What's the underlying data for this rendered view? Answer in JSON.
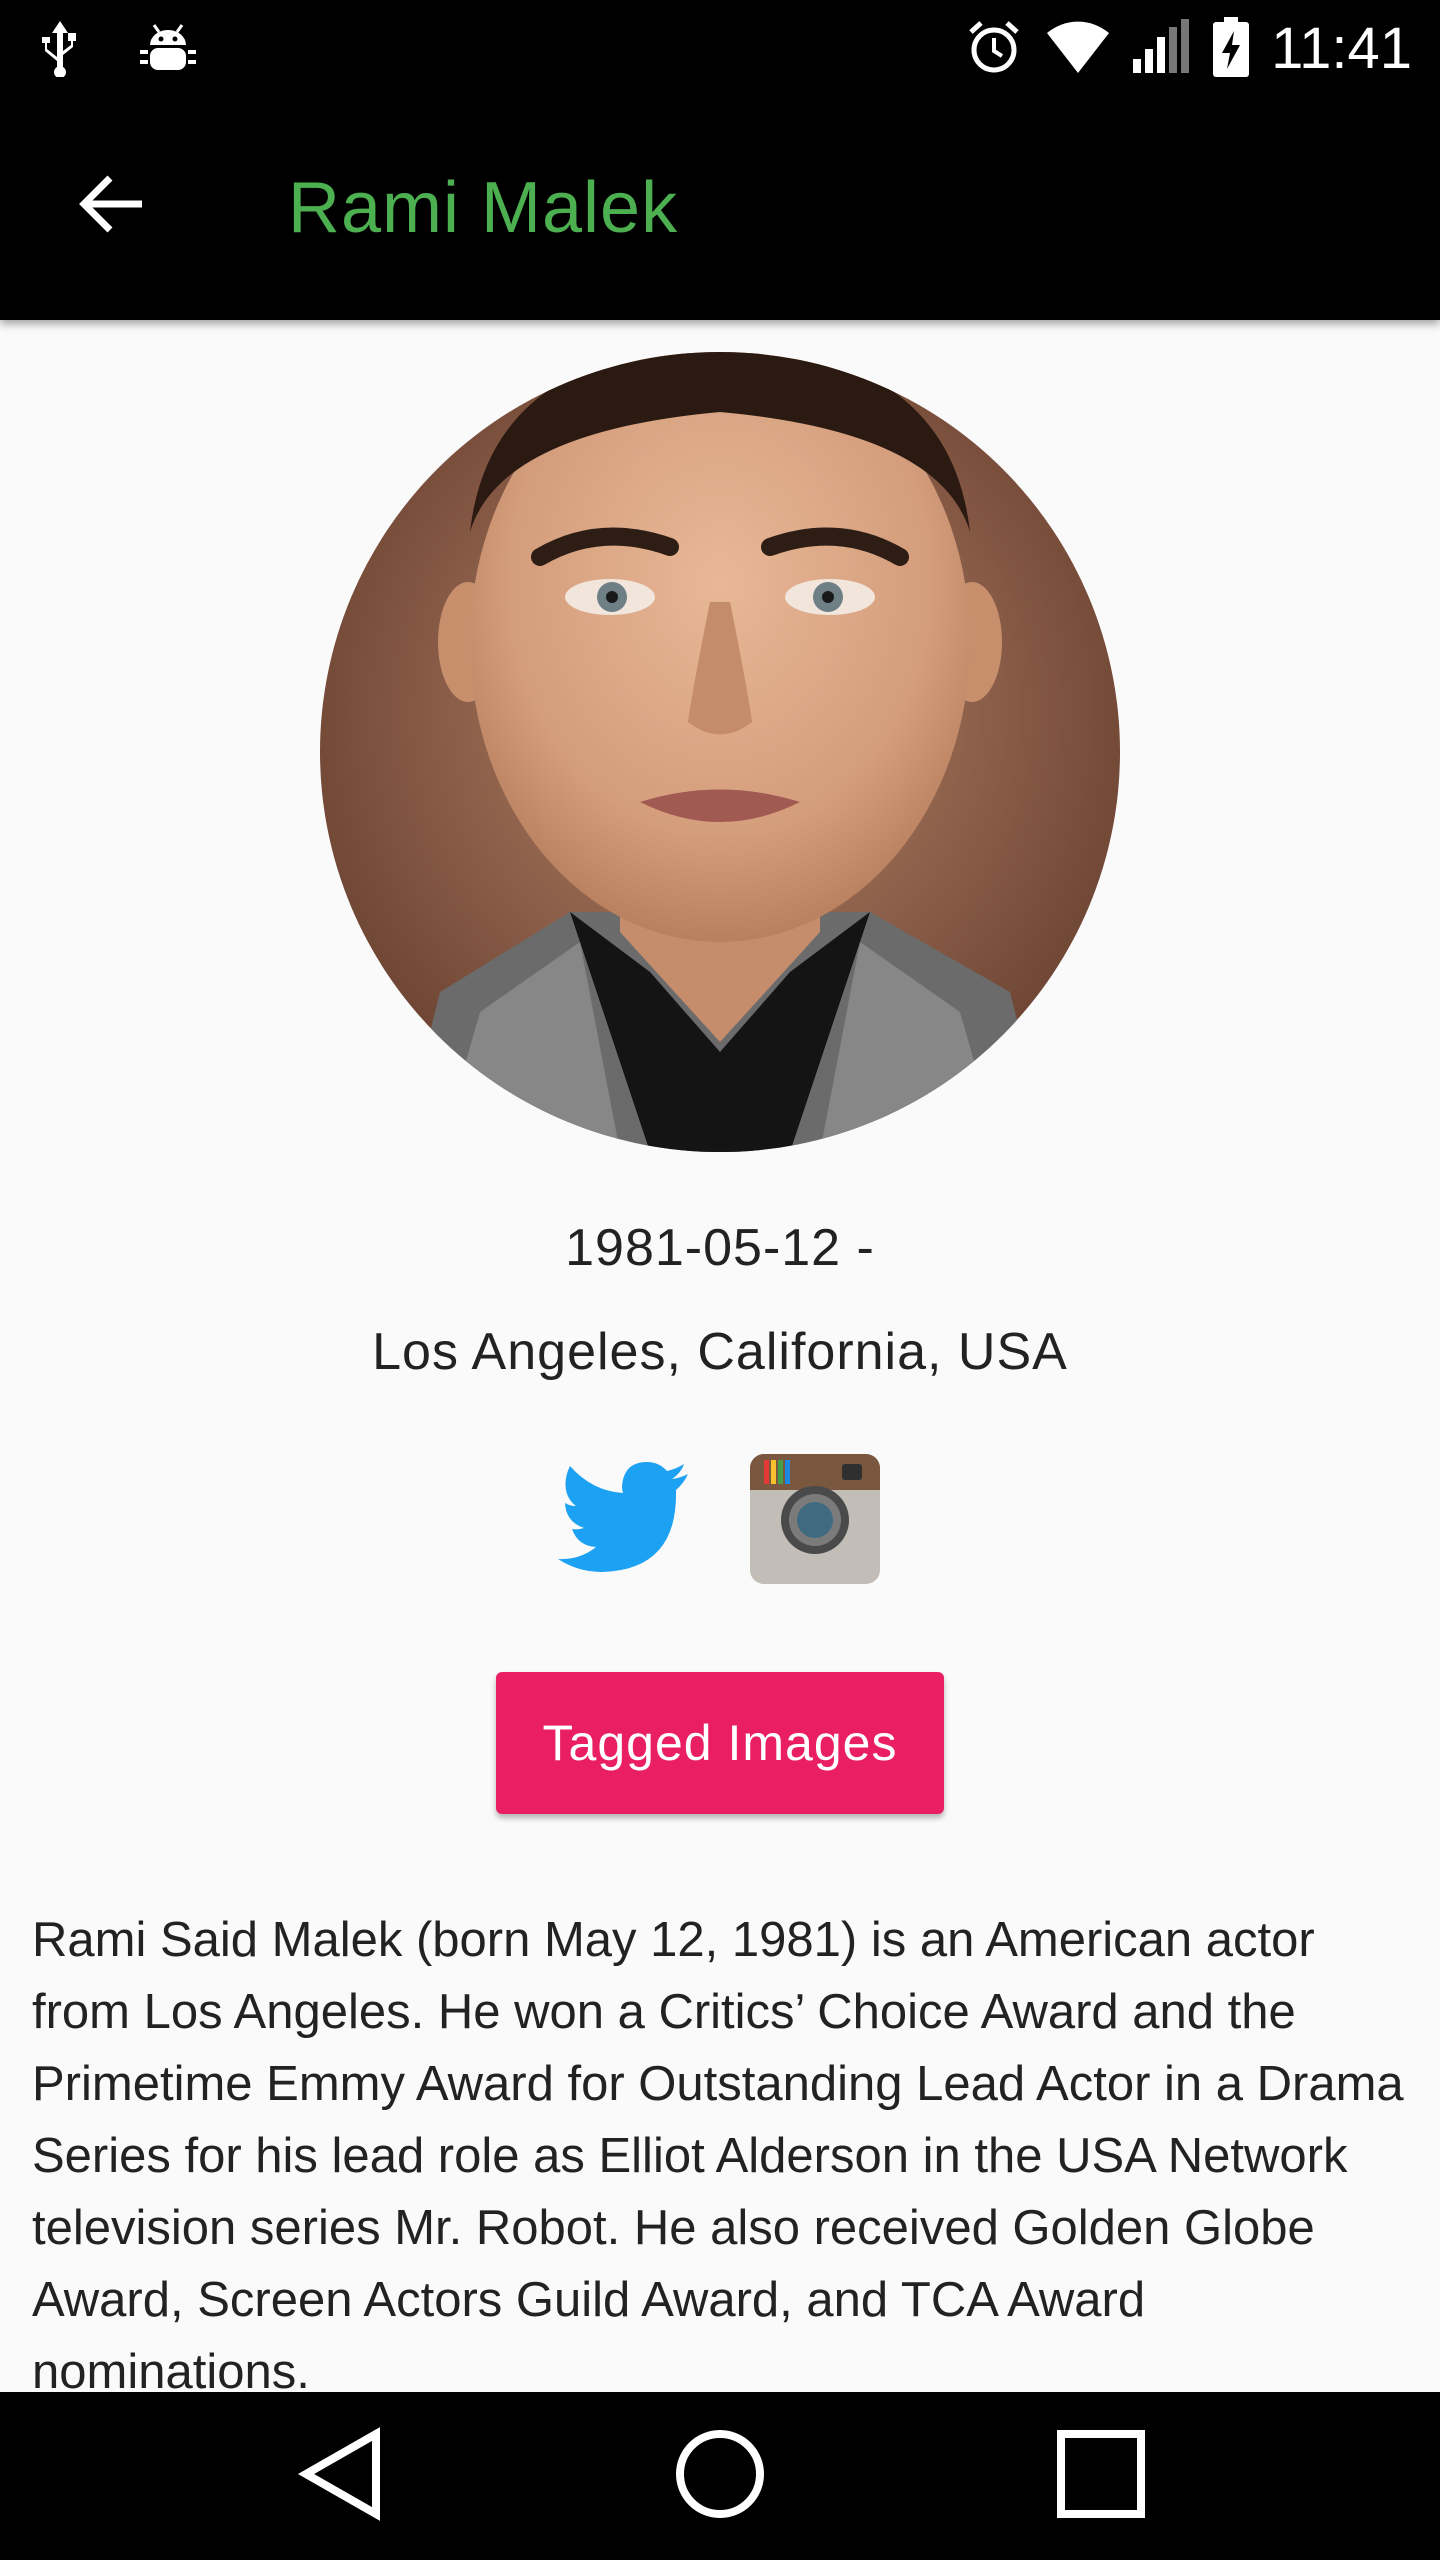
{
  "status_bar": {
    "left_icons": [
      "usb-icon",
      "android-debug-icon"
    ],
    "right_icons": [
      "alarm-icon",
      "wifi-icon",
      "signal-icon",
      "battery-charging-icon"
    ],
    "time": "11:41"
  },
  "app_bar": {
    "back_icon": "arrow-back-icon",
    "title": "Rami Malek",
    "title_color": "#4caf50"
  },
  "profile": {
    "birth": "1981-05-12 -",
    "birthplace": "Los Angeles, California, USA",
    "social": [
      {
        "name": "twitter",
        "icon": "twitter-icon",
        "color": "#1da1f2"
      },
      {
        "name": "instagram",
        "icon": "instagram-icon"
      }
    ],
    "tagged_button_label": "Tagged Images",
    "tagged_button_color": "#e91e63",
    "bio": "Rami Said Malek (born May 12, 1981) is an American actor from Los Angeles. He won a Critics’ Choice Award and the Primetime Emmy Award for Outstanding Lead Actor in a Drama Series for his lead role as Elliot Alderson in the USA Network television series Mr. Robot. He also received Golden Globe Award, Screen Actors Guild Award, and TCA Award nominations."
  },
  "nav_bar": {
    "buttons": [
      "back-triangle-icon",
      "home-circle-icon",
      "recents-square-icon"
    ]
  }
}
